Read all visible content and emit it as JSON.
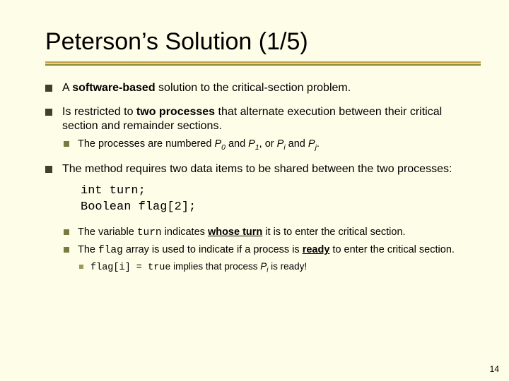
{
  "title": "Peterson’s Solution (1/5)",
  "bullets": {
    "b1": {
      "pre": "A ",
      "strong": "software-based",
      "post": " solution to the critical-section problem."
    },
    "b2": {
      "pre": "Is restricted to ",
      "strong": "two processes",
      "post": " that alternate execution between their critical section and remainder sections."
    },
    "b2sub": {
      "pre": "The processes are numbered ",
      "p0": "P",
      "p0s": "0",
      "and1": " and ",
      "p1": "P",
      "p1s": "1",
      "or": ", or ",
      "pi": "P",
      "pis": "i",
      "and2": " and ",
      "pj": "P",
      "pjs": "j",
      "dot": "."
    },
    "b3": "The method requires two data items to be shared between the two processes:",
    "code1": "int turn;",
    "code2": "Boolean flag[2];",
    "b3a": {
      "pre": "The variable ",
      "code": "turn",
      "mid": " indicates ",
      "u": "whose turn",
      "post": " it is to enter the critical section."
    },
    "b3b": {
      "pre": "The ",
      "code": "flag",
      "mid": " array is used to indicate if a process is ",
      "strong": "ready",
      "post": " to enter the critical section."
    },
    "b3c": {
      "code": "flag[i] = true",
      "mid": " implies that process ",
      "pi": "P",
      "pis": "i",
      "post": " is ready!"
    }
  },
  "pagenum": "14"
}
